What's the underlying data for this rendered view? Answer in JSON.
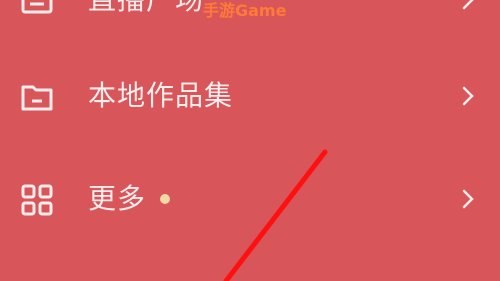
{
  "watermark": "手游Game",
  "menu": {
    "items": [
      {
        "label": "直播广场",
        "icon": "tv-icon"
      },
      {
        "label": "本地作品集",
        "icon": "folder-icon"
      },
      {
        "label": "更多",
        "icon": "grid-icon",
        "badge": "dot"
      }
    ]
  },
  "colors": {
    "background": "#d85559",
    "text": "#f8ecec",
    "badge": "#f3d9a5",
    "annotation_stroke": "#ff1010",
    "watermark": "#ff7a38"
  }
}
